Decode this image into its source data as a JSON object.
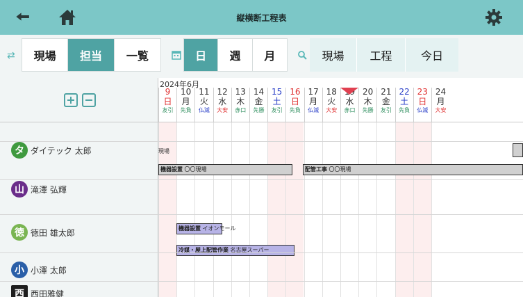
{
  "header": {
    "title": "縦横断工程表"
  },
  "toolbar": {
    "group_view": [
      "現場",
      "担当",
      "一覧"
    ],
    "group_view_active": 1,
    "group_range": [
      "日",
      "週",
      "月"
    ],
    "group_range_active": 0,
    "group_search": [
      "現場",
      "工程",
      "今日"
    ]
  },
  "calendar": {
    "month_label": "2024年6月",
    "days": [
      {
        "d": "9",
        "w": "日",
        "r": "友引",
        "type": "sun"
      },
      {
        "d": "10",
        "w": "月",
        "r": "先負",
        "type": "wk"
      },
      {
        "d": "11",
        "w": "火",
        "r": "仏滅",
        "type": "wk"
      },
      {
        "d": "12",
        "w": "水",
        "r": "大安",
        "type": "wk"
      },
      {
        "d": "13",
        "w": "木",
        "r": "赤口",
        "type": "wk"
      },
      {
        "d": "14",
        "w": "金",
        "r": "先勝",
        "type": "wk"
      },
      {
        "d": "15",
        "w": "土",
        "r": "友引",
        "type": "sat"
      },
      {
        "d": "16",
        "w": "日",
        "r": "先負",
        "type": "sun"
      },
      {
        "d": "17",
        "w": "月",
        "r": "仏滅",
        "type": "wk"
      },
      {
        "d": "18",
        "w": "火",
        "r": "大安",
        "type": "wk"
      },
      {
        "d": "19",
        "w": "水",
        "r": "赤口",
        "type": "wk",
        "today": true
      },
      {
        "d": "20",
        "w": "木",
        "r": "先勝",
        "type": "wk"
      },
      {
        "d": "21",
        "w": "金",
        "r": "友引",
        "type": "wk"
      },
      {
        "d": "22",
        "w": "土",
        "r": "先負",
        "type": "sat"
      },
      {
        "d": "23",
        "w": "日",
        "r": "仏滅",
        "type": "sun"
      },
      {
        "d": "24",
        "w": "月",
        "r": "大安",
        "type": "wk"
      }
    ]
  },
  "people": [
    {
      "initial": "タ",
      "name": "ダイテック 太郎",
      "color": "#3f9a3f"
    },
    {
      "initial": "山",
      "name": "滝澤 弘輝",
      "color": "#6a2d8a"
    },
    {
      "initial": "徳",
      "name": "徳田 雄太郎",
      "color": "#7ab552"
    },
    {
      "initial": "小",
      "name": "小澤 太郎",
      "color": "#2a5fa8"
    },
    {
      "initial": "西",
      "name": "西田雅健",
      "color": "#1e1e1e"
    }
  ],
  "tasks": {
    "label_genba": "現場",
    "t1": {
      "type": "機器設置",
      "site": "〇〇現場"
    },
    "t2": {
      "type": "配管工事",
      "site": "〇〇現場"
    },
    "t3": {
      "type": "機器設置",
      "site": "イオンモール"
    },
    "t4": {
      "type": "冷媒・屋上配管作業",
      "site": "名古屋スーパー"
    }
  },
  "colors": {
    "header_bg": "#7cc7c7",
    "active_bg": "#4fa3a3",
    "weekend_bg": "#fdeeee",
    "sunday_red": "#e03030",
    "saturday_blue": "#2a3fc8",
    "task_gray": "#d0d0d0",
    "task_purple": "#b7b3e6"
  },
  "icons": {
    "back": "arrow-left-icon",
    "home": "home-icon",
    "settings": "gear-icon",
    "swap": "swap-arrows-icon",
    "calendar": "calendar-icon",
    "search": "search-icon",
    "expand": "expand-plus-icon",
    "collapse": "collapse-minus-icon"
  }
}
